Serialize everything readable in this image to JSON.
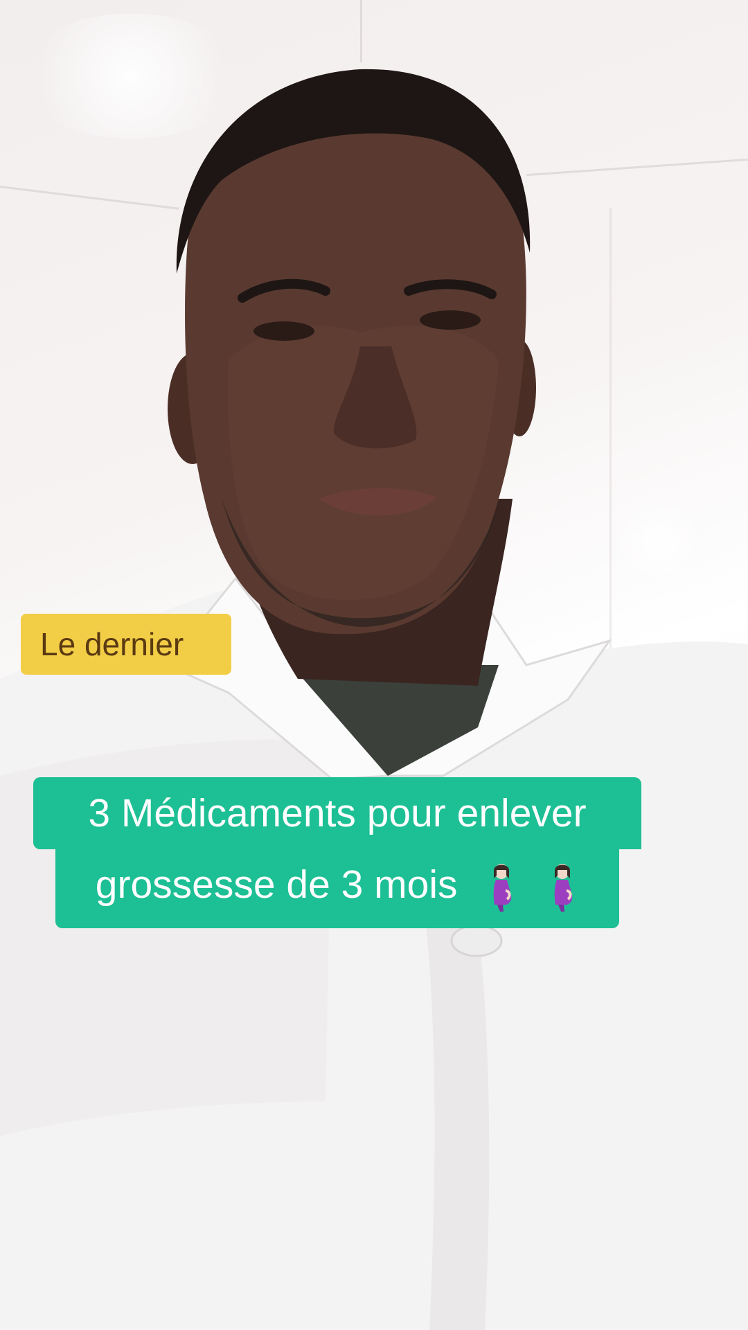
{
  "overlay": {
    "tag_label": "Le dernier",
    "caption_line_1": "3 Médicaments pour enlever",
    "caption_line_2": "grossesse de 3 mois",
    "caption_emoji": "pregnant-woman-emoji",
    "tag_color": "#f2cd46",
    "tag_text_color": "#5a3a12",
    "caption_color": "#1dbf94",
    "caption_text_color": "#ffffff"
  },
  "scene": {
    "subject": "man-in-white-coat",
    "background": "white-tiled-wall"
  }
}
